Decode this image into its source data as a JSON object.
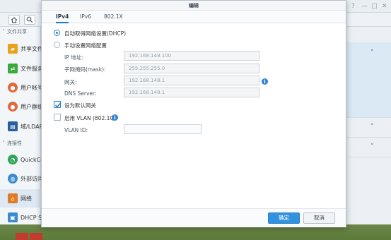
{
  "dialog": {
    "title": "编辑",
    "tabs": [
      "IPv4",
      "IPv6",
      "802.1X"
    ],
    "active_tab": "IPv4",
    "options": {
      "dhcp_label": "自动取得网络设置(DHCP)",
      "manual_label": "手动设置网络配置",
      "selected": "dhcp"
    },
    "fields": {
      "ip": {
        "label": "IP 地址:",
        "value": "192.168.148.100"
      },
      "mask": {
        "label": "子网掩码(mask):",
        "value": "255.255.255.0"
      },
      "gateway": {
        "label": "网关:",
        "value": "192.168.148.1"
      },
      "dns": {
        "label": "DNS Server:",
        "value": "192.168.148.1"
      }
    },
    "default_gateway": {
      "label": "设为默认网关",
      "checked": true
    },
    "vlan": {
      "label": "启用 VLAN (802.1Q)",
      "checked": false,
      "id_label": "VLAN ID:",
      "id_value": ""
    },
    "buttons": {
      "ok": "确定",
      "cancel": "取消"
    },
    "colors": {
      "accent": "#3392e0",
      "info": "#2f83cf"
    }
  },
  "background": {
    "sidebar": {
      "sections": [
        {
          "label": "文件共享"
        },
        {
          "label": "连接性"
        }
      ],
      "items": [
        {
          "label": "共享文件夹",
          "icon": "folder-share-icon",
          "color": "#e8a21b"
        },
        {
          "label": "文件服务",
          "icon": "file-services-icon",
          "color": "#3aa83a"
        },
        {
          "label": "用户帐号",
          "icon": "user-icon",
          "color": "#e06a3b"
        },
        {
          "label": "用户群组",
          "icon": "group-icon",
          "color": "#e06a3b"
        },
        {
          "label": "域/LDAP",
          "icon": "domain-icon",
          "color": "#2a5f9e"
        },
        {
          "label": "QuickConnect",
          "icon": "quickconnect-icon",
          "color": "#2fa35a"
        },
        {
          "label": "外部访问",
          "icon": "globe-icon",
          "color": "#3a8ad0"
        },
        {
          "label": "网络",
          "icon": "network-icon",
          "color": "#e07b24"
        },
        {
          "label": "DHCP Server",
          "icon": "dhcp-icon",
          "color": "#3a8ad0"
        }
      ],
      "active_item": "网络"
    }
  }
}
